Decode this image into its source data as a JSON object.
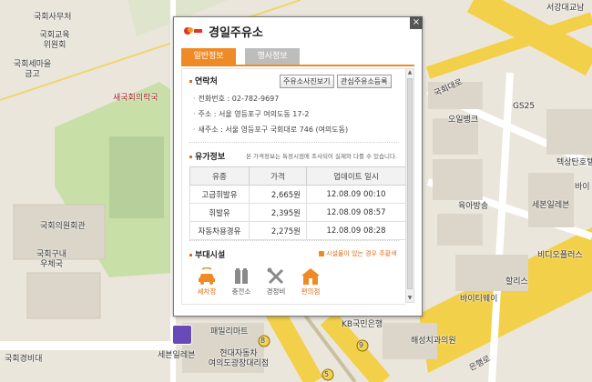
{
  "map": {
    "labels": [
      {
        "id": "national-assembly-office",
        "text": "국회사무처"
      },
      {
        "id": "assembly-education-institute",
        "text": "국회교육\n위원회"
      },
      {
        "id": "assembly-seminar-hall",
        "text": "국회세마을\n금고"
      },
      {
        "id": "saenuri",
        "text": "새국회의락국"
      },
      {
        "id": "assembly-members-hall",
        "text": "국회의원회관"
      },
      {
        "id": "assembly-post-office",
        "text": "국회구내\n우체국"
      },
      {
        "id": "assembly-guard",
        "text": "국회경비대"
      },
      {
        "id": "seogang-bridge",
        "text": "서강대교남"
      },
      {
        "id": "gukhoe-daero",
        "text": "국회대로"
      },
      {
        "id": "gs25",
        "text": "GS25"
      },
      {
        "id": "ori-bank",
        "text": "오일뱅크"
      },
      {
        "id": "tesan-hotel",
        "text": "텍상탄호텔"
      },
      {
        "id": "bai",
        "text": "바이"
      },
      {
        "id": "yugsa-bang",
        "text": "육아방송"
      },
      {
        "id": "sebon-residence",
        "text": "세본일레븐"
      },
      {
        "id": "bidiocore",
        "text": "비디오플러스"
      },
      {
        "id": "hollis",
        "text": "할리스"
      },
      {
        "id": "baiti-way",
        "text": "바이티웨이"
      },
      {
        "id": "kb-bank",
        "text": "KB국민은행"
      },
      {
        "id": "haesung-clinic",
        "text": "해성치과의원"
      },
      {
        "id": "hyundai-motor",
        "text": "현대자동차\n여의도광장대리점"
      },
      {
        "id": "semyong-eleven",
        "text": "세븐일레븐"
      },
      {
        "id": "family-mart",
        "text": "패밀리마트"
      },
      {
        "id": "eunhaeng-ro",
        "text": "은행로"
      }
    ],
    "route_numbers": [
      "8",
      "5",
      "9"
    ]
  },
  "popup": {
    "title": "경일주유소",
    "brand_logo": "sk-energy-logo",
    "close": "×",
    "tabs": [
      {
        "label": "일반정보",
        "active": true
      },
      {
        "label": "행사정보",
        "active": false
      }
    ],
    "contact": {
      "title": "연락처",
      "photo_button": "주유소사진보기",
      "register_button": "관심주유소등록",
      "phone": "전화번호 : 02-782-9697",
      "address": "주소 : 서울 영등포구 여의도동 17-2",
      "new_address": "새주소 : 서울 영등포구 국회대로 746 (여의도동)"
    },
    "fuel": {
      "title": "유가정보",
      "notice": "본 가격정보는 특정시점에 조사되어 실제와 다를 수 있습니다.",
      "columns": [
        "유종",
        "가격",
        "업데이트 일시"
      ],
      "rows": [
        {
          "type": "고급휘발유",
          "price": "2,665원",
          "updated": "12.08.09 00:10"
        },
        {
          "type": "휘발유",
          "price": "2,395원",
          "updated": "12.08.09 08:57"
        },
        {
          "type": "자동차용경유",
          "price": "2,275원",
          "updated": "12.08.09 08:28"
        }
      ]
    },
    "facilities": {
      "title": "부대시설",
      "notice": "시설물이 있는 경우 주황색",
      "items": [
        {
          "label": "세차장",
          "icon": "car-wash-icon",
          "available": true
        },
        {
          "label": "충전소",
          "icon": "charging-station-icon",
          "available": false
        },
        {
          "label": "경정비",
          "icon": "repair-tools-icon",
          "available": false
        },
        {
          "label": "편의점",
          "icon": "convenience-store-icon",
          "available": true
        }
      ]
    }
  },
  "colors": {
    "accent": "#ef8b26",
    "tab_inactive": "#bdbdbd",
    "road_yellow": "#f7d44a",
    "park_green": "#c8dfa8"
  }
}
